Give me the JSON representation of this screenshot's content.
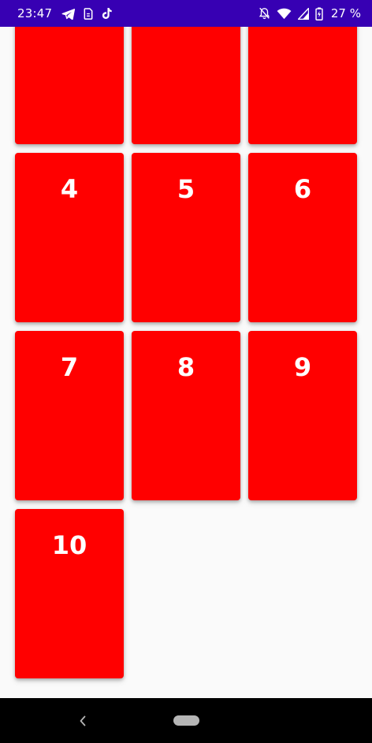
{
  "status_bar": {
    "time": "23:47",
    "battery_percent": "27 %",
    "background_color": "#3700b3",
    "left_icons": [
      "telegram-icon",
      "sim-card-icon",
      "tiktok-icon"
    ],
    "right_icons": [
      "notifications-off-icon",
      "wifi-icon",
      "cell-signal-icon",
      "battery-charging-icon"
    ]
  },
  "grid": {
    "card_color": "#ff0000",
    "cards": [
      {
        "label": ""
      },
      {
        "label": ""
      },
      {
        "label": ""
      },
      {
        "label": "4"
      },
      {
        "label": "5"
      },
      {
        "label": "6"
      },
      {
        "label": "7"
      },
      {
        "label": "8"
      },
      {
        "label": "9"
      },
      {
        "label": "10"
      }
    ]
  },
  "nav_bar": {
    "icons": [
      "back-icon",
      "home-pill-icon"
    ]
  }
}
